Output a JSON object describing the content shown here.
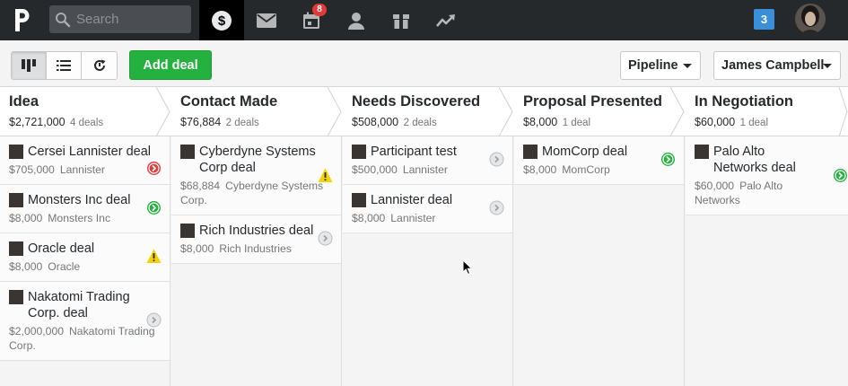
{
  "nav": {
    "search_placeholder": "Search",
    "activities_badge": "8",
    "notifications_count": "3"
  },
  "toolbar": {
    "add_deal_label": "Add deal",
    "pipeline_label": "Pipeline",
    "user_label": "James Campbell"
  },
  "stages": [
    {
      "name": "Idea",
      "total": "$2,721,000",
      "count": "4 deals",
      "deals": [
        {
          "title": "Cersei Lannister deal",
          "value": "$705,000",
          "org": "Lannister",
          "status": "red"
        },
        {
          "title": "Monsters Inc deal",
          "value": "$8,000",
          "org": "Monsters Inc",
          "status": "green"
        },
        {
          "title": "Oracle deal",
          "value": "$8,000",
          "org": "Oracle",
          "status": "warning"
        },
        {
          "title": "Nakatomi Trading Corp. deal",
          "value": "$2,000,000",
          "org": "Nakatomi Trading Corp.",
          "status": "grey"
        }
      ]
    },
    {
      "name": "Contact Made",
      "total": "$76,884",
      "count": "2 deals",
      "deals": [
        {
          "title": "Cyberdyne Systems Corp deal",
          "value": "$68,884",
          "org": "Cyberdyne Systems Corp.",
          "status": "warning"
        },
        {
          "title": "Rich Industries deal",
          "value": "$8,000",
          "org": "Rich Industries",
          "status": "grey"
        }
      ]
    },
    {
      "name": "Needs Discovered",
      "total": "$508,000",
      "count": "2 deals",
      "deals": [
        {
          "title": "Participant test",
          "value": "$500,000",
          "org": "Lannister",
          "status": "grey"
        },
        {
          "title": "Lannister deal",
          "value": "$8,000",
          "org": "Lannister",
          "status": "grey"
        }
      ]
    },
    {
      "name": "Proposal Presented",
      "total": "$8,000",
      "count": "1 deal",
      "deals": [
        {
          "title": "MomCorp deal",
          "value": "$8,000",
          "org": "MomCorp",
          "status": "green"
        }
      ]
    },
    {
      "name": "In Negotiation",
      "total": "$60,000",
      "count": "1 deal",
      "deals": [
        {
          "title": "Palo Alto Networks deal",
          "value": "$60,000",
          "org": "Palo Alto Networks",
          "status": "green"
        }
      ]
    }
  ],
  "colors": {
    "topbar": "#26292c",
    "accent_green": "#25b13f",
    "status_red": "#e03a3a",
    "status_green": "#25b13f",
    "status_warning": "#f5d300",
    "status_grey": "#b9bbbd",
    "badge_red": "#e03a3a",
    "notif_blue": "#3b8fd8"
  }
}
